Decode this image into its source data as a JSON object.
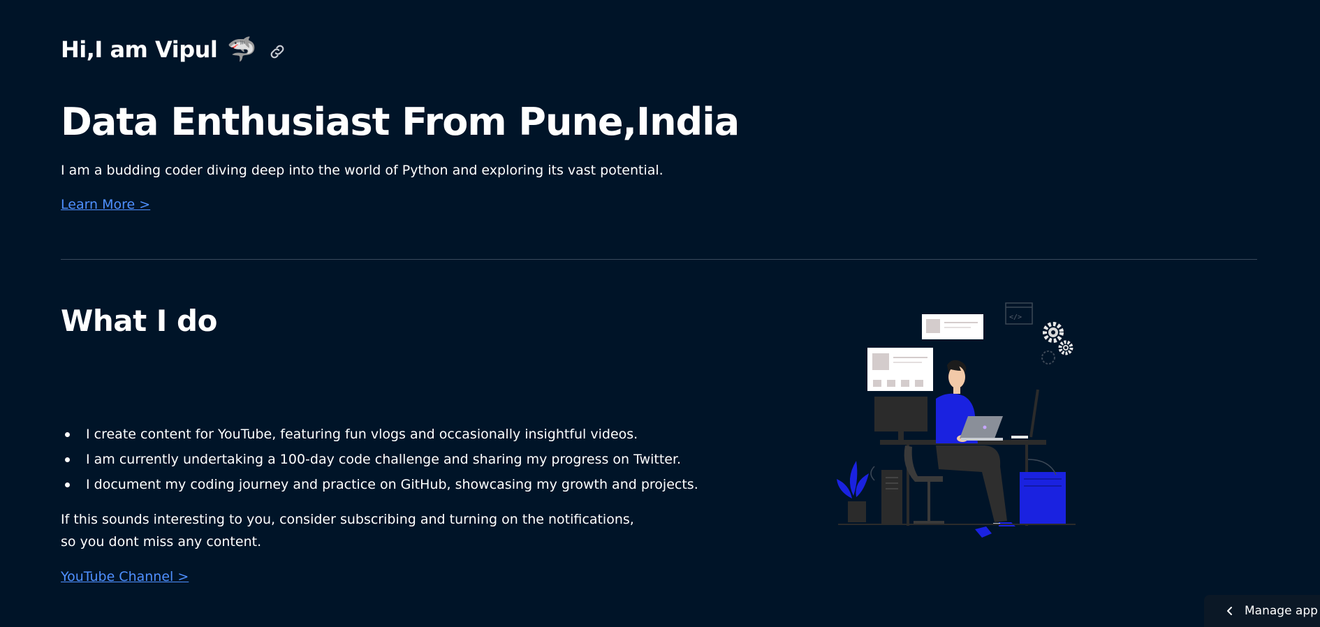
{
  "hero": {
    "greeting": "Hi,I am Vipul",
    "greeting_emoji": "🦈",
    "headline": "Data Enthusiast From Pune,India",
    "intro": "I am a budding coder diving deep into the world of Python and exploring its vast potential.",
    "learn_more_label": "Learn More >"
  },
  "what_i_do": {
    "title": "What I do",
    "bullets": [
      "I create content for YouTube, featuring fun vlogs and occasionally insightful videos.",
      "I am currently undertaking a 100-day code challenge and sharing my progress on Twitter.",
      "I document my coding journey and practice on GitHub, showcasing my growth and projects."
    ],
    "cta_text": "If this sounds interesting to you, consider subscribing and turning on the notifications, so you dont miss any content.",
    "youtube_label": "YouTube Channel >"
  },
  "footer": {
    "manage_app_label": "Manage app"
  },
  "icons": {
    "anchor_link": "link-icon",
    "manage_chevron": "chevron-left-icon"
  },
  "colors": {
    "background": "#001428",
    "link": "#4f90ff",
    "divider": "#3a4a5c",
    "accent_blue": "#1a22e0"
  }
}
